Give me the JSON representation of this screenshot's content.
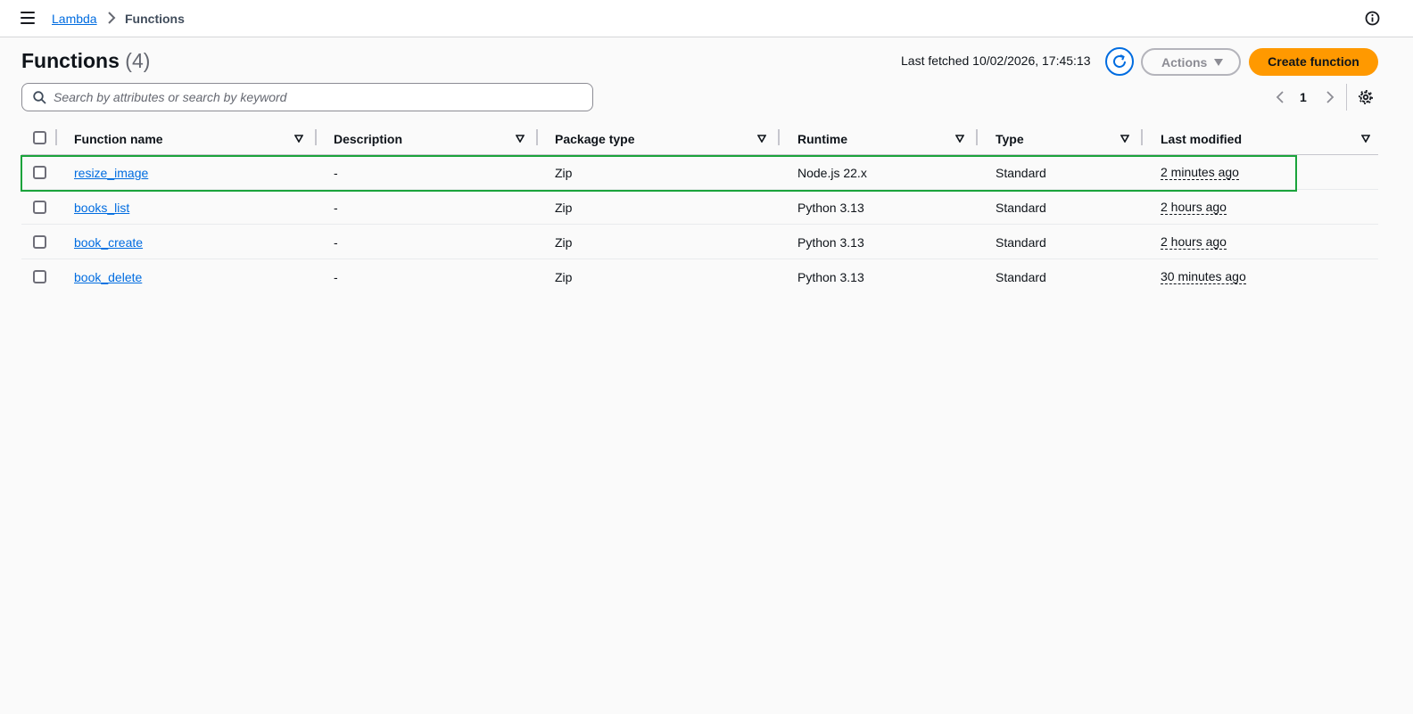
{
  "topbar": {
    "breadcrumb_parent": "Lambda",
    "breadcrumb_current": "Functions"
  },
  "header": {
    "title": "Functions",
    "count": "(4)",
    "last_fetched": "Last fetched 10/02/2026, 17:45:13",
    "actions_label": "Actions",
    "create_label": "Create function"
  },
  "search": {
    "placeholder": "Search by attributes or search by keyword",
    "value": ""
  },
  "pagination": {
    "current_page": "1"
  },
  "table": {
    "columns": [
      "Function name",
      "Description",
      "Package type",
      "Runtime",
      "Type",
      "Last modified"
    ],
    "rows": [
      {
        "name": "resize_image",
        "description": "-",
        "package_type": "Zip",
        "runtime": "Node.js 22.x",
        "type": "Standard",
        "last_modified": "2 minutes ago",
        "highlighted": true
      },
      {
        "name": "books_list",
        "description": "-",
        "package_type": "Zip",
        "runtime": "Python 3.13",
        "type": "Standard",
        "last_modified": "2 hours ago",
        "highlighted": false
      },
      {
        "name": "book_create",
        "description": "-",
        "package_type": "Zip",
        "runtime": "Python 3.13",
        "type": "Standard",
        "last_modified": "2 hours ago",
        "highlighted": false
      },
      {
        "name": "book_delete",
        "description": "-",
        "package_type": "Zip",
        "runtime": "Python 3.13",
        "type": "Standard",
        "last_modified": "30 minutes ago",
        "highlighted": false
      }
    ]
  },
  "colors": {
    "accent": "#006ce0",
    "primary_button": "#ff9900",
    "highlight_border": "#1aa33b"
  },
  "icons": [
    "menu-icon",
    "chevron-right-icon",
    "info-icon",
    "refresh-icon",
    "caret-down-icon",
    "search-icon",
    "chevron-left-icon",
    "chevron-right-icon",
    "settings-icon",
    "sort-icon"
  ]
}
